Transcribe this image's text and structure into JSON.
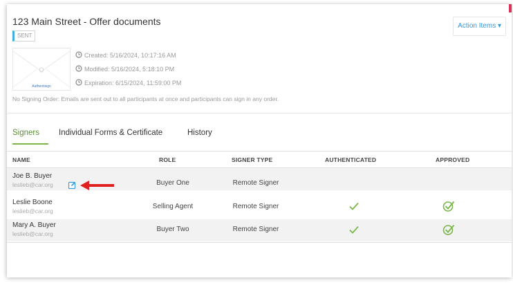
{
  "header": {
    "title": "123 Main Street - Offer documents",
    "status_badge": "SENT",
    "action_button": "Action Items ▾"
  },
  "document": {
    "thumbnail_logo": "Authentisign",
    "created": "Created: 5/16/2024, 10:17:16 AM",
    "modified": "Modified: 5/16/2024, 5:18:10 PM",
    "expiration": "Expiration: 6/15/2024, 11:59:00 PM",
    "signing_note": "No Signing Order: Emails are sent out to all participants at once and participants can sign in any order."
  },
  "tabs": [
    {
      "label": "Signers",
      "active": true
    },
    {
      "label": "Individual Forms & Certificate",
      "active": false
    },
    {
      "label": "History",
      "active": false
    }
  ],
  "table": {
    "columns": [
      "NAME",
      "ROLE",
      "SIGNER TYPE",
      "AUTHENTICATED",
      "APPROVED"
    ],
    "rows": [
      {
        "name": "Joe B. Buyer",
        "email": "leslieb@car.org",
        "role": "Buyer One",
        "signer_type": "Remote Signer",
        "authenticated": false,
        "approved": false,
        "editable": true
      },
      {
        "name": "Leslie Boone",
        "email": "leslieb@car.org",
        "role": "Selling Agent",
        "signer_type": "Remote Signer",
        "authenticated": true,
        "approved": true,
        "editable": false
      },
      {
        "name": "Mary A. Buyer",
        "email": "leslieb@car.org",
        "role": "Buyer Two",
        "signer_type": "Remote Signer",
        "authenticated": true,
        "approved": true,
        "editable": false
      }
    ]
  },
  "colors": {
    "accent_green": "#7ab648",
    "link_blue": "#3498db",
    "badge_blue": "#40b0e0",
    "annotation_red": "#e02020"
  },
  "icons": [
    "clock-icon",
    "edit-icon",
    "checkmark-icon",
    "check-circle-icon",
    "red-arrow-icon",
    "dropdown-caret"
  ]
}
